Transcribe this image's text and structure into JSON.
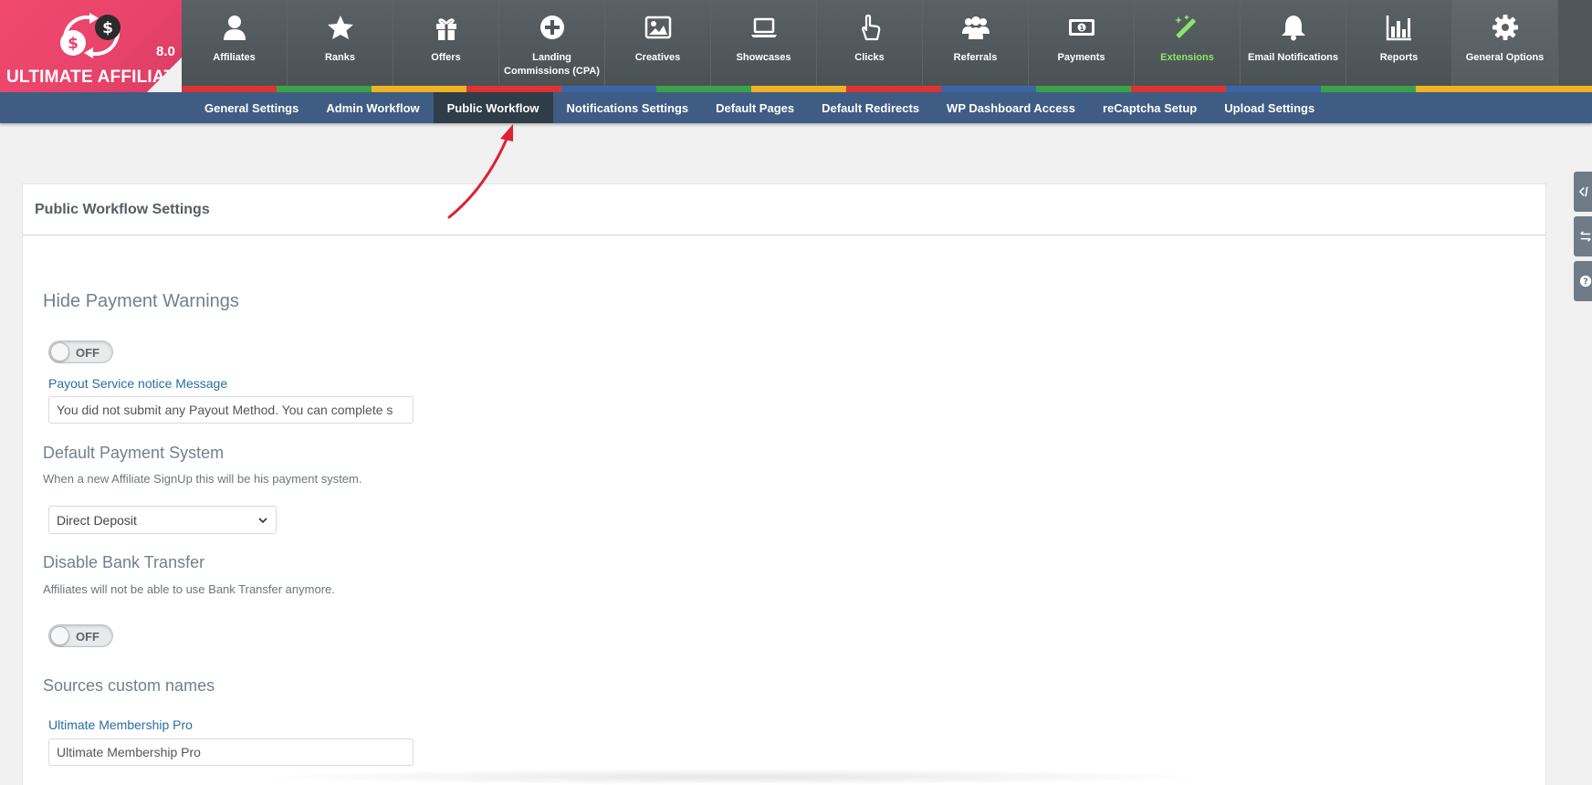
{
  "logo": {
    "brand": "ULTIMATE AFFILIATE",
    "version": "8.0"
  },
  "menu": [
    {
      "label": "Affiliates",
      "icon": "user-icon"
    },
    {
      "label": "Ranks",
      "icon": "star-icon"
    },
    {
      "label": "Offers",
      "icon": "gift-icon"
    },
    {
      "label": "Landing Commissions (CPA)",
      "icon": "plus-circle-icon"
    },
    {
      "label": "Creatives",
      "icon": "image-icon"
    },
    {
      "label": "Showcases",
      "icon": "laptop-icon"
    },
    {
      "label": "Clicks",
      "icon": "pointer-hand-icon"
    },
    {
      "label": "Referrals",
      "icon": "users-icon"
    },
    {
      "label": "Payments",
      "icon": "money-icon"
    },
    {
      "label": "Extensions",
      "icon": "magic-wand-icon"
    },
    {
      "label": "Email Notifications",
      "icon": "bell-icon"
    },
    {
      "label": "Reports",
      "icon": "bar-chart-icon"
    },
    {
      "label": "General Options",
      "icon": "gear-icon"
    }
  ],
  "colors": {
    "accent_strip": [
      "#dd3333",
      "#3aa349",
      "#f0b323",
      "#dd3333",
      "#3b67a8",
      "#3aa349",
      "#f0b323",
      "#dd3333",
      "#3b67a8",
      "#3aa349",
      "#dd3333",
      "#3b67a8",
      "#3aa349",
      "#f0b323"
    ],
    "submenu_bg": "#3f5d84",
    "extensions_highlight": "#8be46c",
    "annotation_arrow": "#dd2330"
  },
  "submenu": [
    "General Settings",
    "Admin Workflow",
    "Public Workflow",
    "Notifications Settings",
    "Default Pages",
    "Default Redirects",
    "WP Dashboard Access",
    "reCaptcha Setup",
    "Upload Settings"
  ],
  "panel": {
    "title": "Public Workflow Settings",
    "hide_payment_warnings": {
      "title": "Hide Payment Warnings",
      "toggle_state": "OFF",
      "field_label": "Payout Service notice Message",
      "field_value": "You did not submit any Payout Method. You can complete s"
    },
    "default_payment_system": {
      "title": "Default Payment System",
      "description": "When a new Affiliate SignUp this will be his payment system.",
      "selected": "Direct Deposit"
    },
    "disable_bank_transfer": {
      "title": "Disable Bank Transfer",
      "description": "Affiliates will not be able to use Bank Transfer anymore.",
      "toggle_state": "OFF"
    },
    "sources_custom_names": {
      "title": "Sources custom names",
      "field_label": "Ultimate Membership Pro",
      "field_value": "Ultimate Membership Pro"
    }
  }
}
